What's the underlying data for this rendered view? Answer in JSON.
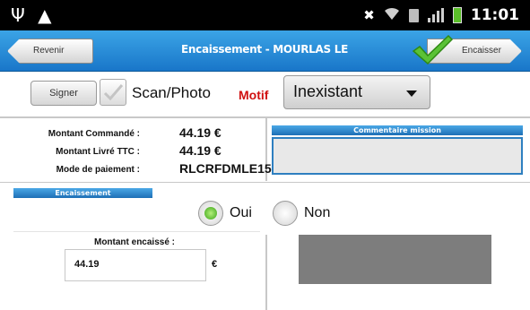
{
  "status_bar": {
    "time": "11:01",
    "icons": [
      "usb-icon",
      "warning-icon",
      "mute-icon",
      "wifi-icon",
      "sim-icon",
      "signal-icon",
      "battery-icon"
    ]
  },
  "header": {
    "title": "Encaissement - MOURLAS LE",
    "back_label": "Revenir",
    "confirm_label": "Encaisser",
    "accent_color": "#1976c9",
    "check_color": "#5bc236"
  },
  "toolbar": {
    "sign_label": "Signer",
    "scan_label": "Scan/Photo",
    "scan_checked": true,
    "motif_label": "Motif",
    "motif_value": "Inexistant"
  },
  "info": {
    "ordered_label": "Montant Commandé :",
    "ordered_value": "44.19 €",
    "delivered_label": "Montant Livré TTC :",
    "delivered_value": "44.19 €",
    "payment_label": "Mode de paiement :",
    "payment_value": "RLCRFDMLE15"
  },
  "comment": {
    "header": "Commentaire mission",
    "value": ""
  },
  "encaissement": {
    "header": "Encaissement",
    "oui_label": "Oui",
    "non_label": "Non",
    "selected": "Oui",
    "amount_label": "Montant encaissé :",
    "amount_value": "44.19",
    "currency": "€"
  }
}
